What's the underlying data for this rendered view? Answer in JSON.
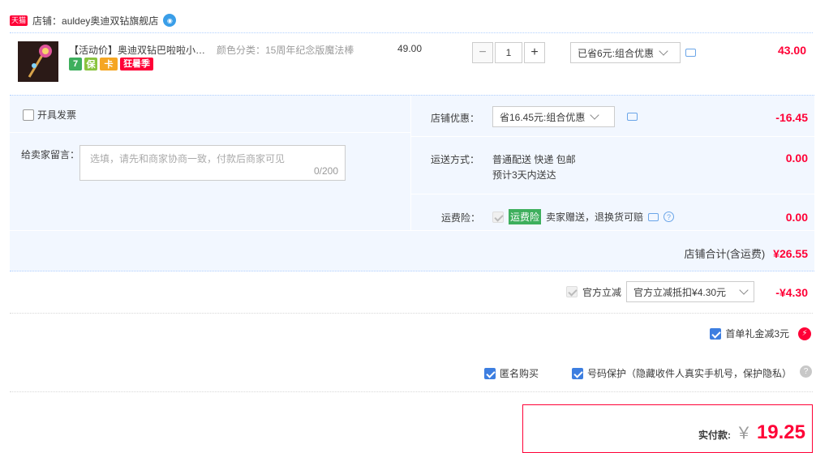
{
  "store": {
    "badge": "天猫",
    "name": "店铺：auldey奥迪双钻旗舰店",
    "chat_icon": "wangwang-chat-icon"
  },
  "item": {
    "title": "【活动价】奥迪双钻巴啦啦小魔…",
    "sku": "颜色分类：15周年纪念版魔法棒",
    "badges": [
      "7",
      "保",
      "卡",
      "狂暑季"
    ],
    "unit_price": "49.00",
    "quantity": "1",
    "promo_select": "已省6元:组合优惠",
    "subtotal": "43.00"
  },
  "invoice": {
    "label": "开具发票"
  },
  "message": {
    "label": "给卖家留言：",
    "placeholder": "选填，请先和商家协商一致，付款后商家可见",
    "counter": "0/200"
  },
  "shop_discount": {
    "label": "店铺优惠：",
    "select": "省16.45元:组合优惠",
    "amount": "-16.45"
  },
  "shipping": {
    "label": "运送方式：",
    "method": "普通配送 快递 包邮",
    "eta": "预计3天内送达",
    "amount": "0.00"
  },
  "insurance": {
    "label": "运费险：",
    "tag": "运费险",
    "text": "卖家赠送，退换货可赔",
    "amount": "0.00"
  },
  "shop_total": {
    "label": "店铺合计(含运费)",
    "amount": "¥26.55"
  },
  "official_discount": {
    "label": "官方立减",
    "select": "官方立减抵扣¥4.30元",
    "amount": "-¥4.30"
  },
  "first_order": {
    "label": "首单礼金减3元"
  },
  "anonymous": {
    "label": "匿名购买"
  },
  "privacy": {
    "label": "号码保护（隐藏收件人真实手机号，保护隐私）"
  },
  "payment": {
    "label": "实付款:",
    "currency": "￥",
    "amount": "19.25"
  },
  "colors": {
    "accent_red": "#ff0036",
    "panel_bg": "#f2f7ff",
    "checkbox_blue": "#3d7ee0"
  }
}
